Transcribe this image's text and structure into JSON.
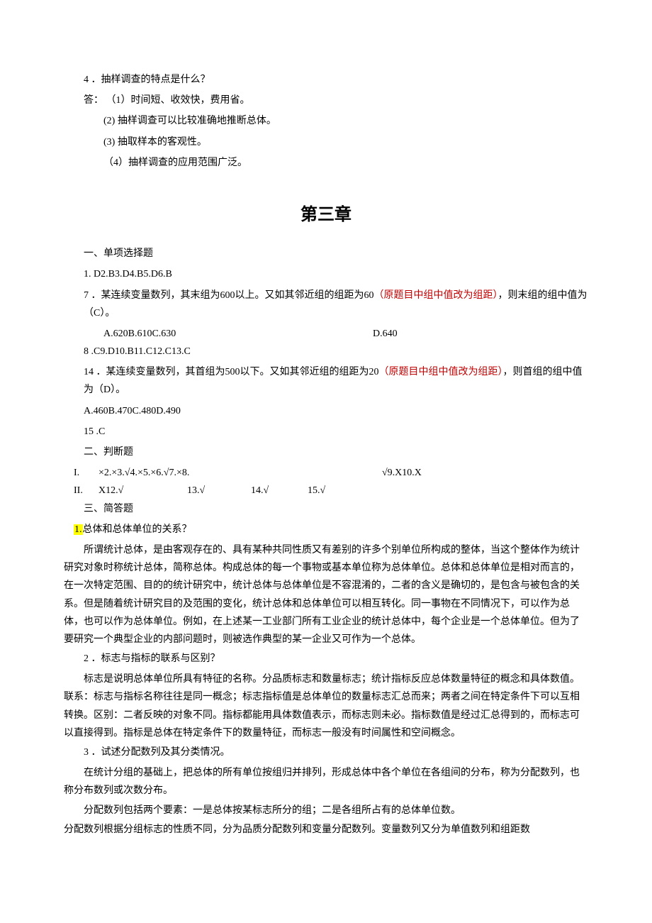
{
  "q4": {
    "num": "4",
    "title": "．抽样调查的特点是什么？",
    "a_prefix": "答：",
    "a1": "（1）时间短、收效快，费用省。",
    "a2": "(2) 抽样调查可以比较准确地推断总体。",
    "a3": "(3) 抽取样本的客观性。",
    "a4": "（4）抽样调查的应用范围广泛。"
  },
  "chapter": "第三章",
  "sec1": {
    "heading": "一、单项选择题",
    "line1": "1.   D2.B3.D4.B5.D6.B",
    "q7": {
      "num": "7",
      "text_a": "．某连续变量数列，其末组为600以上。又如其邻近组的组距为60",
      "red": "（原题目中组中值改为组距）",
      "text_b": "，则末组的组中值为（C）。",
      "opts_a": "A.620B.610C.630",
      "opts_d": "D.640"
    },
    "line8": "8      .C9.D10.B11.C12.C13.C",
    "q14": {
      "num": "14",
      "text_a": "．某连续变量数列，其首组为500以下。又如其邻近组的组距为20",
      "red": "（原题目中组中值改为组距）",
      "text_b": "，则首组的组中值为（D）。",
      "opts": "A.460B.470C.480D.490"
    },
    "line15": "15      .C"
  },
  "sec2": {
    "heading": "二、判断题",
    "row1": {
      "label": "I.",
      "a": "×2.×3.√4.×5.×6.√7.×8.",
      "b": "√9.X10.X"
    },
    "row2": {
      "label": "II.",
      "a": "X12.√",
      "b": "13.√",
      "c": "14.√",
      "d": "15.√"
    }
  },
  "sec3": {
    "heading": "三、简答题",
    "q1": {
      "hl": "1.",
      "title": "总体和总体单位的关系？",
      "body": "所谓统计总体，是由客观存在的、具有某种共同性质又有差别的许多个别单位所构成的整体，当这个整体作为统计研究对象时称统计总体，简称总体。构成总体的每一个事物或基本单位称为总体单位。总体和总体单位是相对而言的，在一次特定范围、目的的统计研究中，统计总体与总体单位是不容混淆的，二者的含义是确切的，是包含与被包含的关系。但是随着统计研究目的及范围的变化，统计总体和总体单位可以相互转化。同一事物在不同情况下，可以作为总体，也可以作为总体单位。例如，在上述某一工业部门所有工业企业的统计总体中，每个企业是一个总体单位。但为了要研究一个典型企业的内部问题时，则被选作典型的某一企业又可作为一个总体。"
    },
    "q2": {
      "num": "2",
      "title": "．标志与指标的联系与区别？",
      "body": "标志是说明总体单位所具有特征的名称。分品质标志和数量标志；统计指标反应总体数量特征的概念和具体数值。联系：标志与指标名称往往是同一概念；标志指标值是总体单位的数量标志汇总而来；两者之间在特定条件下可以互相转换。区别：二者反映的对象不同。指标都能用具体数值表示，而标志则未必。指标数值是经过汇总得到的，而标志可以直接得到。指标是总体在特定条件下的数量特征，而标志一般没有时间属性和空间概念。"
    },
    "q3": {
      "num": "3",
      "title": "．试述分配数列及其分类情况。",
      "p1": "在统计分组的基础上，把总体的所有单位按组归并排列，形成总体中各个单位在各组间的分布，称为分配数列，也称分布数列或次数分布。",
      "p2": "分配数列包括两个要素：一是总体按某标志所分的组；二是各组所占有的总体单位数。",
      "p3": "分配数列根据分组标志的性质不同，分为品质分配数列和变量分配数列。变量数列又分为单值数列和组距数"
    }
  }
}
